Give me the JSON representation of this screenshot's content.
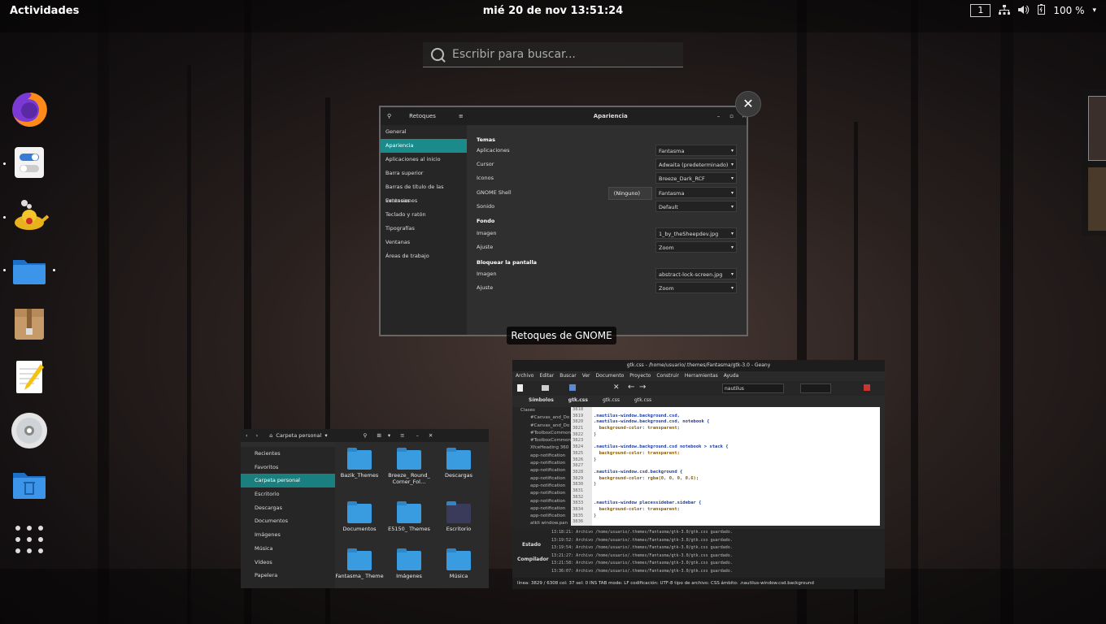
{
  "topbar": {
    "activities": "Actividades",
    "clock": "mié 20 de nov  13:51:24",
    "workspace": "1",
    "battery": "100 %"
  },
  "search": {
    "placeholder": "Escribir para buscar..."
  },
  "dash": {
    "apps": [
      "firefox-icon",
      "tweaks-icon",
      "aladdin-lamp-icon",
      "files-icon",
      "archive-icon",
      "text-editor-icon",
      "disc-icon",
      "trash-folder-icon",
      "app-grid-icon"
    ]
  },
  "tweaks": {
    "title": "Retoques",
    "page": "Apariencia",
    "label": "Retoques de GNOME",
    "sidebar": [
      "General",
      "Apariencia",
      "Aplicaciones al inicio",
      "Barra superior",
      "Barras de título de las ventanas",
      "Extensiones",
      "Teclado y ratón",
      "Tipografías",
      "Ventanas",
      "Áreas de trabajo"
    ],
    "sections": {
      "temas": "Temas",
      "fondo": "Fondo",
      "bloquear": "Bloquear la pantalla"
    },
    "rows": {
      "aplicaciones": {
        "label": "Aplicaciones",
        "value": "Fantasma"
      },
      "cursor": {
        "label": "Cursor",
        "value": "Adwaita (predeterminado)"
      },
      "iconos": {
        "label": "Iconos",
        "value": "Breeze_Dark_RCF"
      },
      "shell": {
        "label": "GNOME Shell",
        "value": "Fantasma",
        "extra": "(Ninguno)"
      },
      "sonido": {
        "label": "Sonido",
        "value": "Default"
      },
      "fondo_imagen": {
        "label": "Imagen",
        "value": "1_by_theSheepdev.jpg"
      },
      "fondo_ajuste": {
        "label": "Ajuste",
        "value": "Zoom"
      },
      "lock_imagen": {
        "label": "Imagen",
        "value": "abstract-lock-screen.jpg"
      },
      "lock_ajuste": {
        "label": "Ajuste",
        "value": "Zoom"
      }
    }
  },
  "files": {
    "location": "Carpeta personal",
    "sidebar": [
      "Recientes",
      "Favoritos",
      "Carpeta personal",
      "Escritorio",
      "Descargas",
      "Documentos",
      "Imágenes",
      "Música",
      "Vídeos",
      "Papelera"
    ],
    "items": [
      "Bazik_Themes",
      "Breeze_ Round_ Corner_Fol…",
      "Descargas",
      "Documentos",
      "E5150_ Themes",
      "Escritorio",
      "Fantasma_ Theme",
      "Imágenes",
      "Música"
    ]
  },
  "geany": {
    "title": "gtk.css - /home/usuario/.themes/Fantasma/gtk-3.0 - Geany",
    "menu": [
      "Archivo",
      "Editar",
      "Buscar",
      "Ver",
      "Documento",
      "Proyecto",
      "Construir",
      "Herramientas",
      "Ayuda"
    ],
    "search_value": "nautilus",
    "tabs": [
      "Símbolos",
      "gtk.css",
      "gtk.css",
      "gtk.css"
    ],
    "symbols": [
      "Clases",
      "#Canvas_and_Do",
      "#Canvas_and_Do",
      "#ToolboxCommon",
      "#ToolboxCommon",
      "XfceHeading 360",
      "app-notification",
      "app-notification",
      "app-notification",
      "app-notification",
      "app-notification",
      "app-notification",
      "app-notification",
      "app-notification",
      "app-notification",
      "atkli window.pan"
    ],
    "line_numbers": [
      "3818",
      "3819",
      "3820",
      "3821",
      "3822",
      "3823",
      "3824",
      "3825",
      "3826",
      "3827",
      "3828",
      "3829",
      "3830",
      "3831",
      "3832",
      "3833",
      "3834",
      "3835",
      "3836"
    ],
    "code": [
      "",
      ".nautilus-window.background.csd,",
      ".nautilus-window.background.csd, notebook {",
      "  background-color: transparent;",
      "}",
      "",
      ".nautilus-window.background.csd notebook > stack {",
      "  background-color: transparent;",
      "}",
      "",
      ".nautilus-window.csd.background {",
      "  background-color: rgba(0, 0, 0, 0.6);",
      "}",
      "",
      "",
      ".nautilus-window placessidebar.sidebar {",
      "  background-color: transparent;",
      "}",
      ""
    ],
    "msg_tabs": [
      "Estado",
      "Compilador"
    ],
    "messages": [
      "13:18:21: Archivo /home/usuario/.themes/Fantasma/gtk-3.0/gtk.css guardado.",
      "13:19:52: Archivo /home/usuario/.themes/Fantasma/gtk-3.0/gtk.css guardado.",
      "13:19:54: Archivo /home/usuario/.themes/Fantasma/gtk-3.0/gtk.css guardado.",
      "13:21:27: Archivo /home/usuario/.themes/Fantasma/gtk-3.0/gtk.css guardado.",
      "13:21:58: Archivo /home/usuario/.themes/Fantasma/gtk-3.0/gtk.css guardado.",
      "13:36:07: Archivo /home/usuario/.themes/Fantasma/gtk-3.0/gtk.css guardado."
    ],
    "status": "línea: 3829 / 6308   col: 37     sel: 0     INS     TAB     mode: LF     codificación: UTF-8     tipo de archivo: CSS     ámbito: .nautilus-window.csd.background"
  }
}
